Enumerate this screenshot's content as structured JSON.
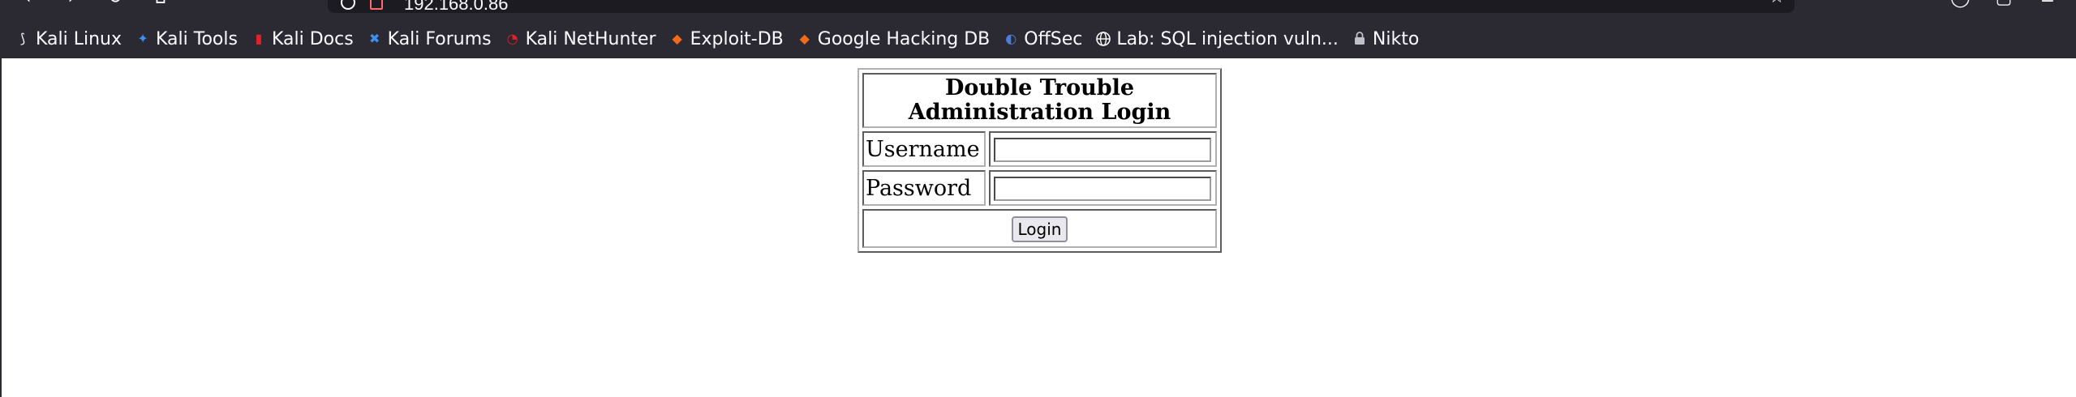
{
  "browser": {
    "url": "192.168.0.86",
    "bookmarks": [
      {
        "label": "Kali Linux",
        "icon": "kali-dragon-icon"
      },
      {
        "label": "Kali Tools",
        "icon": "kali-tools-icon"
      },
      {
        "label": "Kali Docs",
        "icon": "kali-docs-icon"
      },
      {
        "label": "Kali Forums",
        "icon": "kali-forums-icon"
      },
      {
        "label": "Kali NetHunter",
        "icon": "nethunter-icon"
      },
      {
        "label": "Exploit-DB",
        "icon": "exploit-db-icon"
      },
      {
        "label": "Google Hacking DB",
        "icon": "ghdb-icon"
      },
      {
        "label": "OffSec",
        "icon": "offsec-icon"
      },
      {
        "label": "Lab: SQL injection vuln...",
        "icon": "globe-icon"
      },
      {
        "label": "Nikto",
        "icon": "lock-icon"
      }
    ],
    "colors": {
      "chrome": "#2b2a33",
      "urlbar": "#1c1b22",
      "text": "#fbfbfe"
    }
  },
  "form": {
    "title": "Double Trouble Administration Login",
    "username_label": "Username",
    "password_label": "Password",
    "username_value": "",
    "password_value": "",
    "login_label": "Login"
  }
}
